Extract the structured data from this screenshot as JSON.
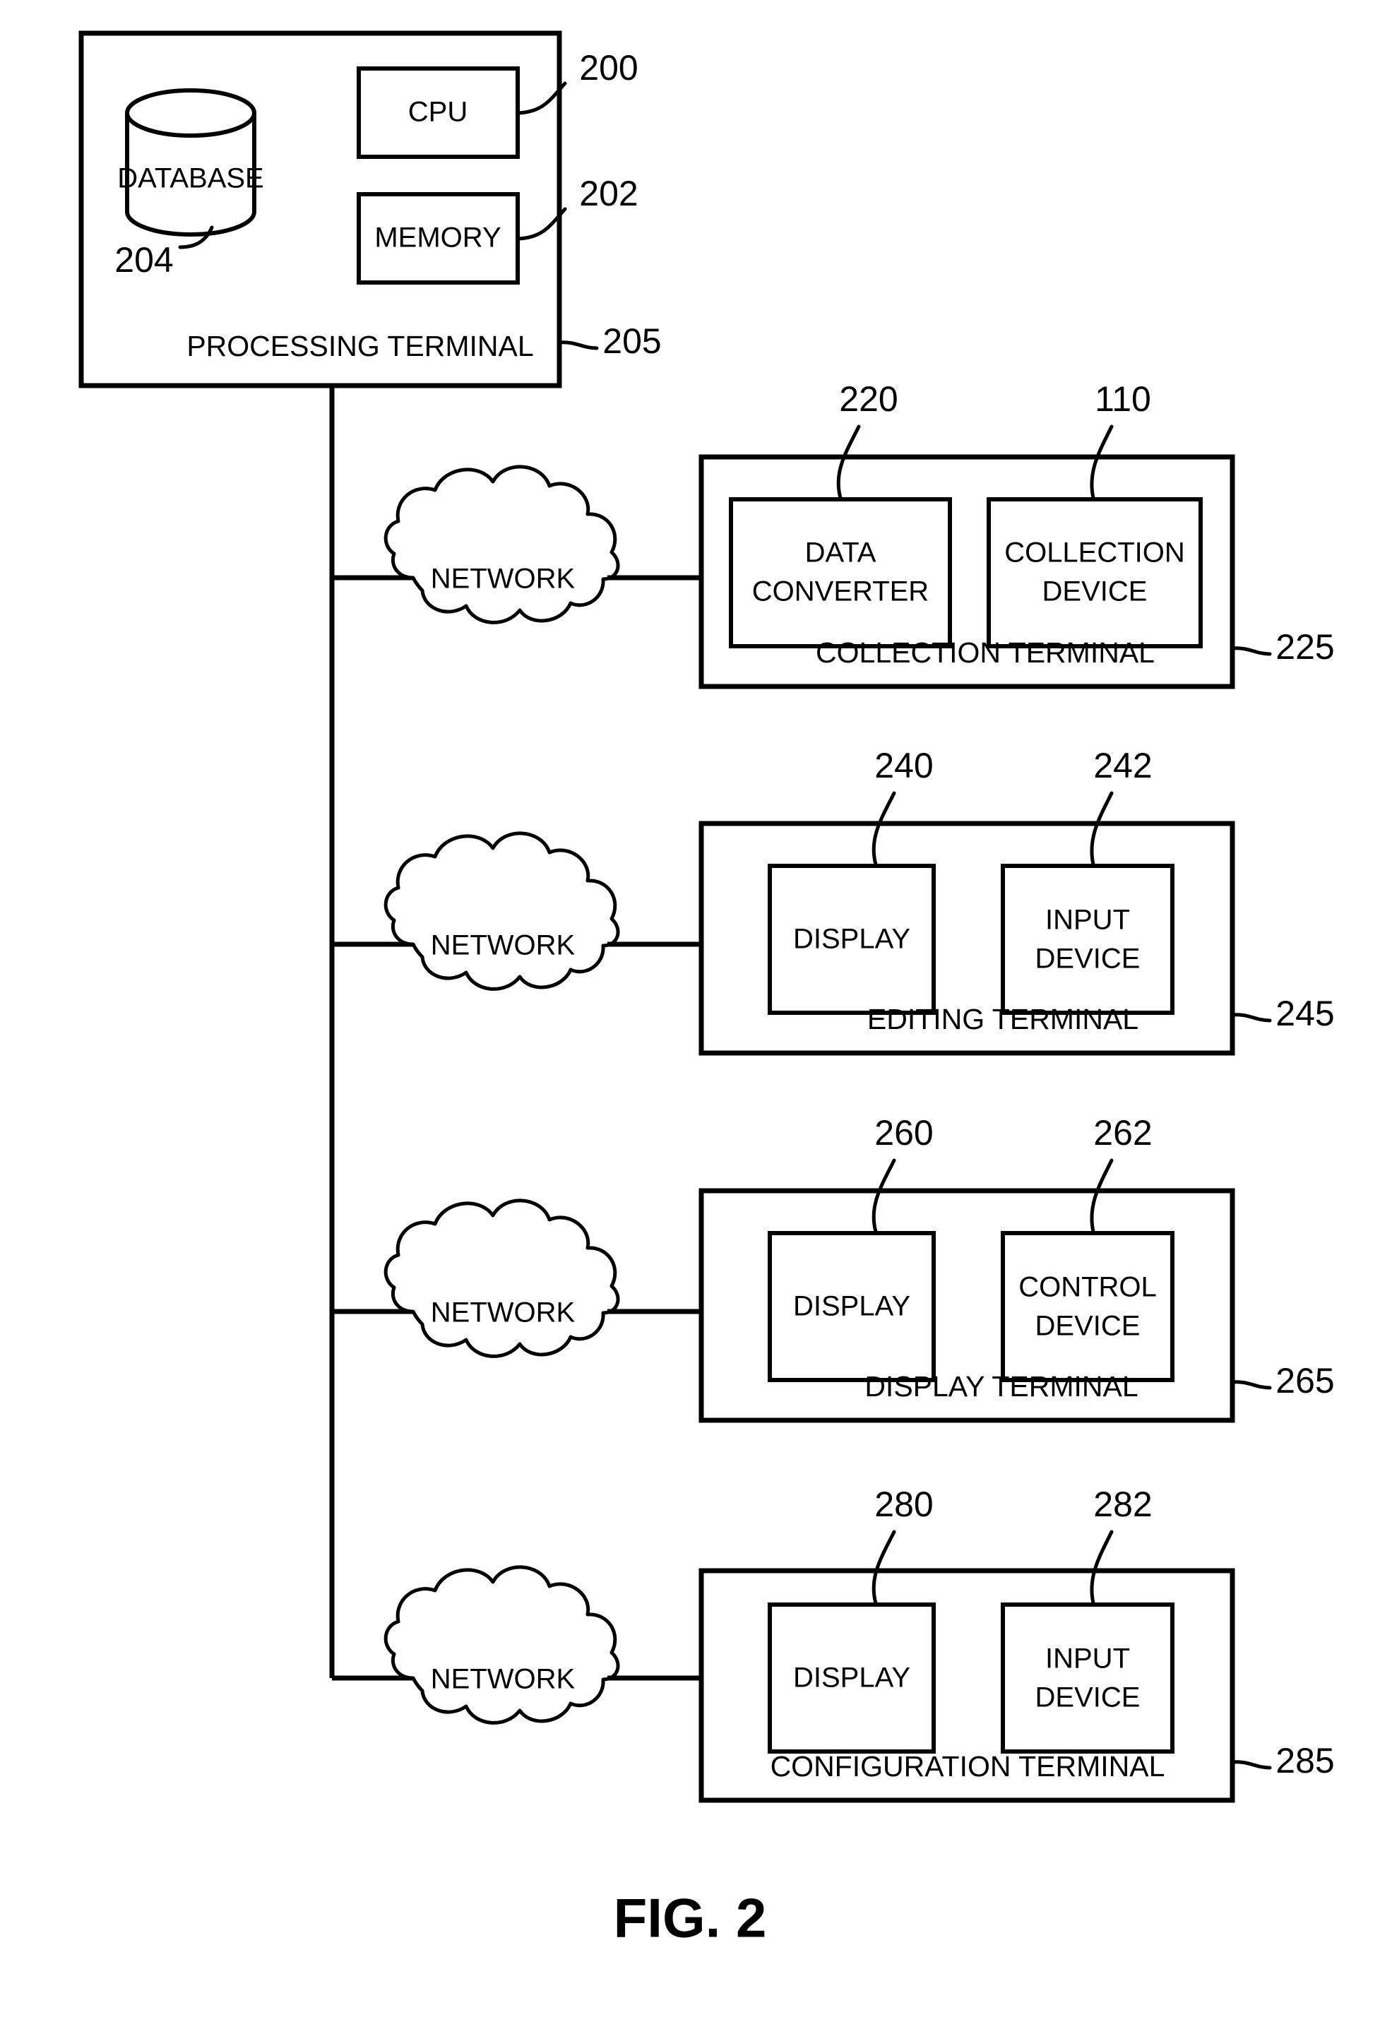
{
  "figure": {
    "caption": "FIG. 2",
    "type": "system-architecture-block-diagram"
  },
  "processing_terminal": {
    "label": "PROCESSING TERMINAL",
    "ref": "205",
    "database": {
      "label": "DATABASE",
      "ref": "204"
    },
    "cpu": {
      "label": "CPU",
      "ref": "200"
    },
    "memory": {
      "label": "MEMORY",
      "ref": "202"
    }
  },
  "networks": [
    {
      "label": "NETWORK"
    },
    {
      "label": "NETWORK"
    },
    {
      "label": "NETWORK"
    },
    {
      "label": "NETWORK"
    }
  ],
  "terminals": [
    {
      "label": "COLLECTION TERMINAL",
      "ref": "225",
      "components": [
        {
          "label_line1": "DATA",
          "label_line2": "CONVERTER",
          "ref": "220"
        },
        {
          "label_line1": "COLLECTION",
          "label_line2": "DEVICE",
          "ref": "110"
        }
      ]
    },
    {
      "label": "EDITING TERMINAL",
      "ref": "245",
      "components": [
        {
          "label_line1": "DISPLAY",
          "label_line2": "",
          "ref": "240"
        },
        {
          "label_line1": "INPUT",
          "label_line2": "DEVICE",
          "ref": "242"
        }
      ]
    },
    {
      "label": "DISPLAY TERMINAL",
      "ref": "265",
      "components": [
        {
          "label_line1": "DISPLAY",
          "label_line2": "",
          "ref": "260"
        },
        {
          "label_line1": "CONTROL",
          "label_line2": "DEVICE",
          "ref": "262"
        }
      ]
    },
    {
      "label": "CONFIGURATION TERMINAL",
      "ref": "285",
      "components": [
        {
          "label_line1": "DISPLAY",
          "label_line2": "",
          "ref": "280"
        },
        {
          "label_line1": "INPUT",
          "label_line2": "DEVICE",
          "ref": "282"
        }
      ]
    }
  ],
  "colors": {
    "stroke": "#000000",
    "background": "#ffffff"
  }
}
